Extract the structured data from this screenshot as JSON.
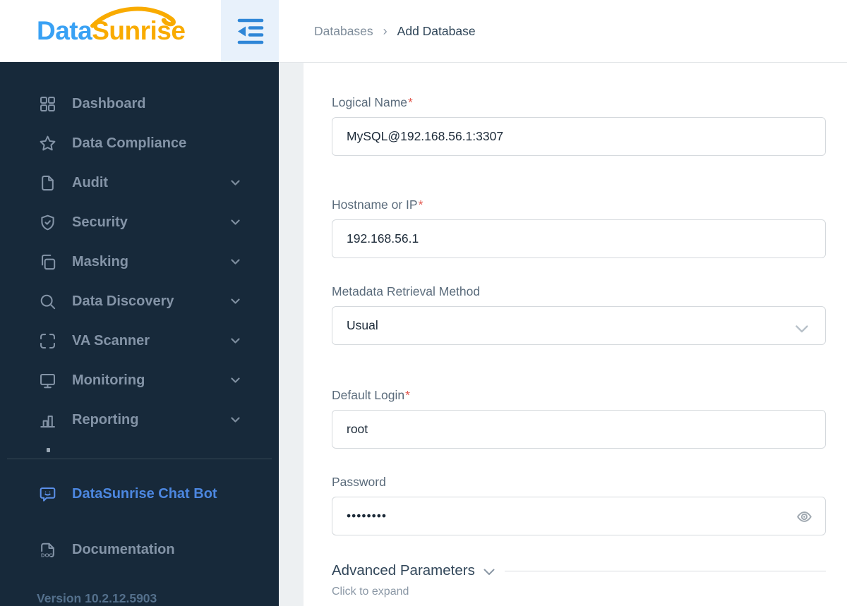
{
  "brand": {
    "word1": "Data",
    "word2": "Sunrise"
  },
  "header": {
    "breadcrumb": [
      "Databases",
      "Add Database"
    ],
    "separator": "›"
  },
  "sidebar": {
    "items": [
      {
        "label": "Dashboard",
        "icon": "dashboard-grid-icon",
        "expandable": false
      },
      {
        "label": "Data Compliance",
        "icon": "star-icon",
        "expandable": false
      },
      {
        "label": "Audit",
        "icon": "document-icon",
        "expandable": true
      },
      {
        "label": "Security",
        "icon": "shield-check-icon",
        "expandable": true
      },
      {
        "label": "Masking",
        "icon": "mask-copy-icon",
        "expandable": true
      },
      {
        "label": "Data Discovery",
        "icon": "search-icon",
        "expandable": true
      },
      {
        "label": "VA Scanner",
        "icon": "scanner-frame-icon",
        "expandable": true
      },
      {
        "label": "Monitoring",
        "icon": "monitor-icon",
        "expandable": true
      },
      {
        "label": "Reporting",
        "icon": "bar-chart-icon",
        "expandable": true
      }
    ],
    "chat_bot_label": "DataSunrise Chat Bot",
    "documentation_label": "Documentation",
    "doc_icon_text": "DOC",
    "version": "Version 10.2.12.5903"
  },
  "form": {
    "required_mark": "*",
    "fields": [
      {
        "label": "Logical Name",
        "required": true,
        "type": "text",
        "value": "MySQL@192.168.56.1:3307"
      },
      {
        "label": "Hostname or IP",
        "required": true,
        "type": "text",
        "value": "192.168.56.1"
      },
      {
        "label": "Metadata Retrieval Method",
        "required": false,
        "type": "select",
        "value": "Usual"
      },
      {
        "label": "Default Login",
        "required": true,
        "type": "text",
        "value": "root"
      },
      {
        "label": "Password",
        "required": false,
        "type": "password",
        "value": "••••••••"
      }
    ],
    "advanced": {
      "title": "Advanced Parameters",
      "hint": "Click to expand"
    }
  },
  "colors": {
    "sidebar_bg": "#17293a",
    "sidebar_text": "#8494a7",
    "logo_blue": "#39a1f4",
    "logo_orange": "#f9ab00",
    "chatbot_blue": "#4c87e0",
    "collapse_btn_bg": "#e8f1fb",
    "collapse_icon_blue": "#2e86d7",
    "required_red": "#e25950",
    "label_gray": "#5a6b7b",
    "input_border": "#d5d9dd",
    "gutter_gray": "#edf0f2"
  }
}
